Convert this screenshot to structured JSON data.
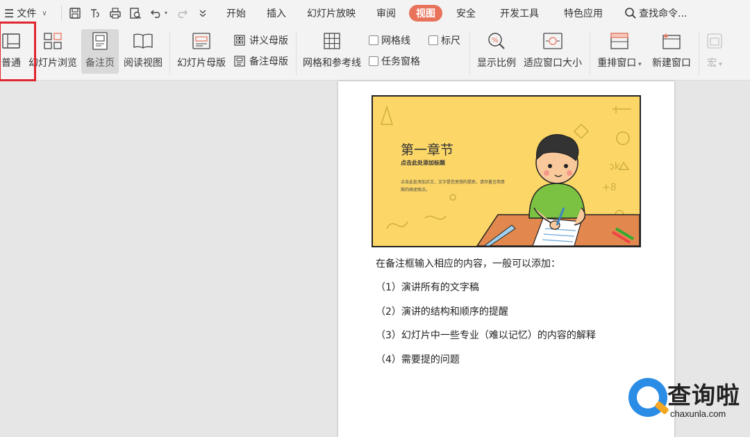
{
  "menubar": {
    "menu_label": "文件",
    "tabs": [
      "开始",
      "插入",
      "幻灯片放映",
      "审阅",
      "视图",
      "安全",
      "开发工具",
      "特色应用"
    ],
    "active_tab": "视图",
    "search_placeholder": "查找命令..."
  },
  "ribbon": {
    "normal": "普通",
    "slide_sorter": "幻灯片浏览",
    "notes_page": "备注页",
    "reading_view": "阅读视图",
    "slide_master": "幻灯片母版",
    "handout_master": "讲义母版",
    "notes_master": "备注母版",
    "grid_guides": "网格和参考线",
    "gridlines": "网格线",
    "ruler": "标尺",
    "task_pane": "任务窗格",
    "zoom": "显示比例",
    "fit_window": "适应窗口大小",
    "arrange": "重排窗口",
    "new_window": "新建窗口",
    "macro": "宏"
  },
  "slide": {
    "title": "第一章节",
    "subtitle": "点击此处添加标题",
    "body": "点击此处添加正文，文字是您思想的提炼，请尽量言简意赅的阐述观点。"
  },
  "notes": {
    "intro": "在备注框输入相应的内容，一般可以添加：",
    "items": [
      "（1）演讲所有的文字稿",
      "（2）演讲的结构和顺序的提醒",
      "（3）幻灯片中一些专业（难以记忆）的内容的解释",
      "（4）需要提的问题"
    ]
  },
  "watermark": {
    "cn": "查询啦",
    "en": "chaxunla.com"
  },
  "colors": {
    "active_tab": "#e8735a",
    "highlight_box": "#e0262e",
    "slide_bg": "#fcd768"
  }
}
